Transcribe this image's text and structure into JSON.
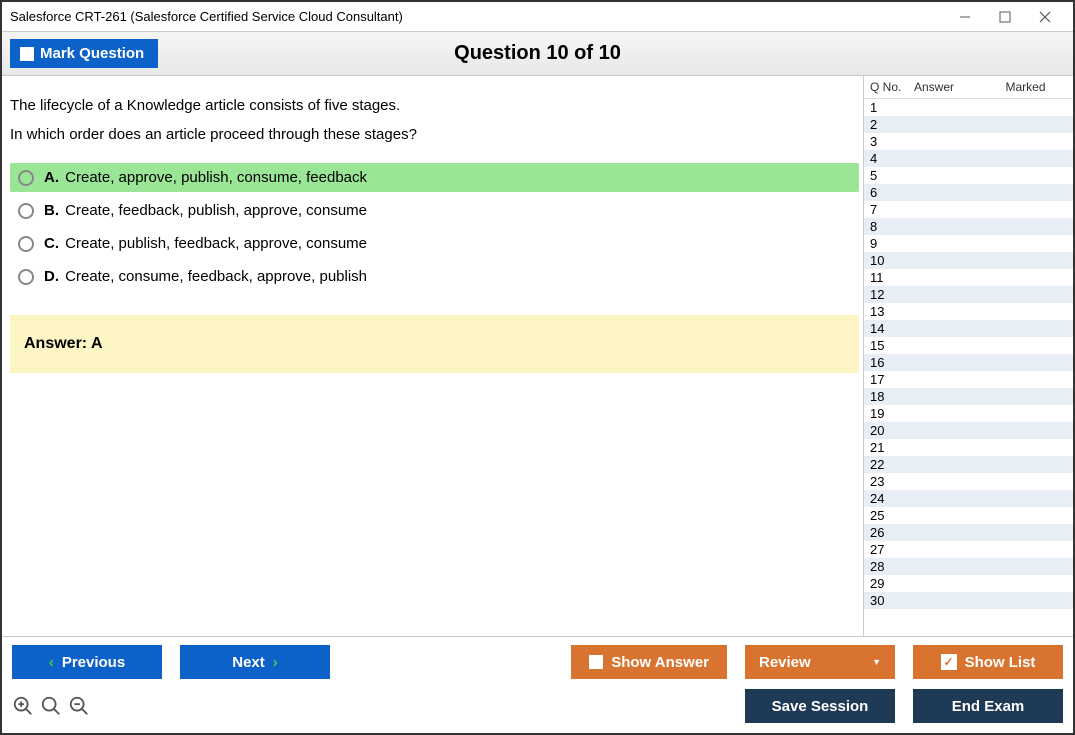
{
  "window": {
    "title": "Salesforce CRT-261 (Salesforce Certified Service Cloud Consultant)"
  },
  "header": {
    "mark_label": "Mark Question",
    "question_title": "Question 10 of 10"
  },
  "question": {
    "text_line1": "The lifecycle of a Knowledge article consists of five stages.",
    "text_line2": "In which order does an article proceed through these stages?",
    "options": [
      {
        "letter": "A.",
        "text": "Create, approve, publish, consume, feedback",
        "selected": true
      },
      {
        "letter": "B.",
        "text": "Create, feedback, publish, approve, consume",
        "selected": false
      },
      {
        "letter": "C.",
        "text": "Create, publish, feedback, approve, consume",
        "selected": false
      },
      {
        "letter": "D.",
        "text": "Create, consume, feedback, approve, publish",
        "selected": false
      }
    ],
    "answer_label": "Answer: A"
  },
  "sidebar": {
    "col1": "Q No.",
    "col2": "Answer",
    "col3": "Marked",
    "rows": [
      1,
      2,
      3,
      4,
      5,
      6,
      7,
      8,
      9,
      10,
      11,
      12,
      13,
      14,
      15,
      16,
      17,
      18,
      19,
      20,
      21,
      22,
      23,
      24,
      25,
      26,
      27,
      28,
      29,
      30
    ]
  },
  "footer": {
    "previous": "Previous",
    "next": "Next",
    "show_answer": "Show Answer",
    "review": "Review",
    "show_list": "Show List",
    "save_session": "Save Session",
    "end_exam": "End Exam"
  }
}
